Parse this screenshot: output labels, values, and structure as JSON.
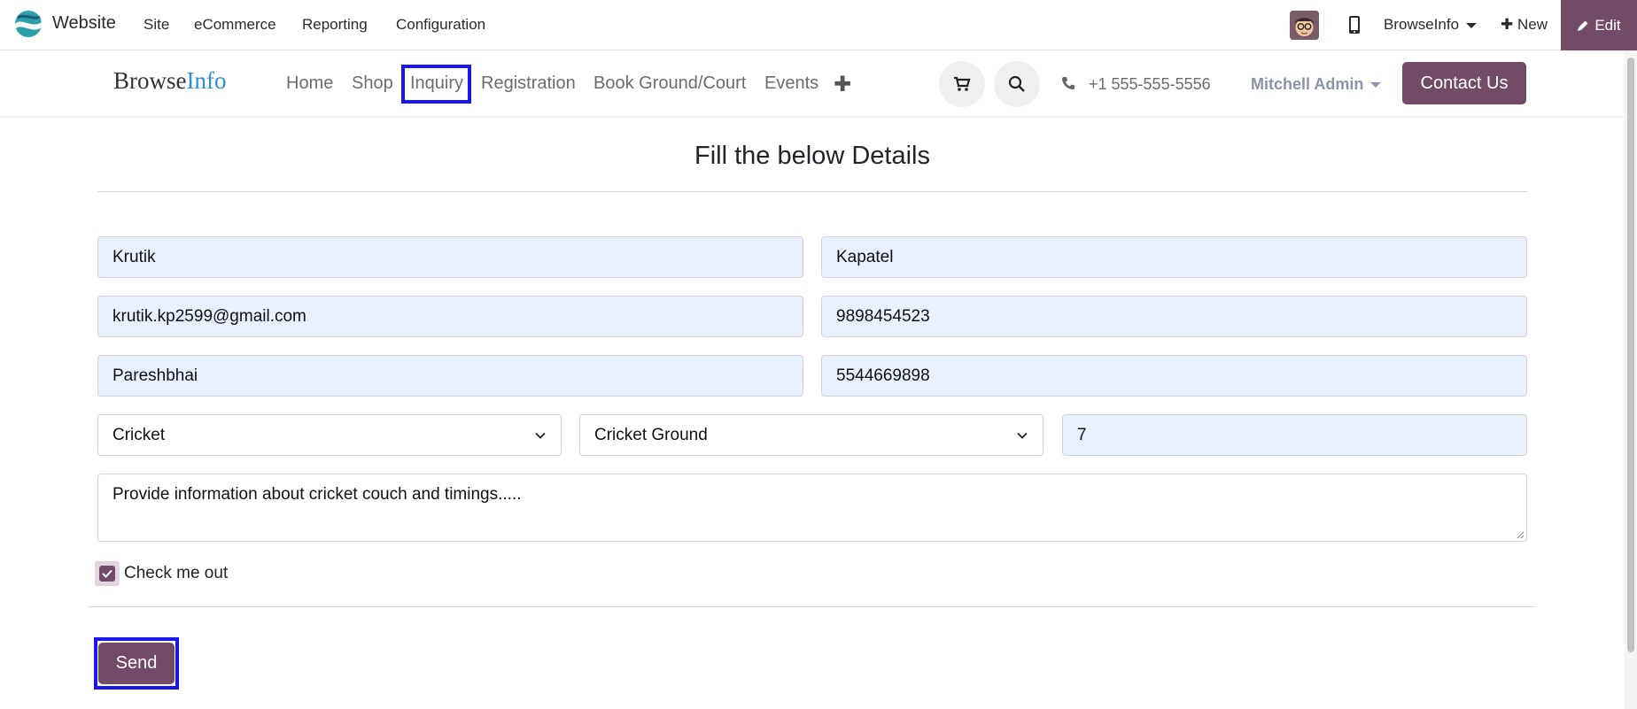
{
  "admin_bar": {
    "app_name": "Website",
    "menu": [
      "Site",
      "eCommerce",
      "Reporting",
      "Configuration"
    ],
    "website_switcher": "BrowseInfo",
    "new_label": "New",
    "edit_label": "Edit"
  },
  "site_header": {
    "brand_part1": "Browse",
    "brand_part2": "Info",
    "nav": [
      "Home",
      "Shop",
      "Inquiry",
      "Registration",
      "Book Ground/Court",
      "Events"
    ],
    "active_nav": "Inquiry",
    "phone": "+1 555-555-5556",
    "user": "Mitchell Admin",
    "contact_label": "Contact Us"
  },
  "form": {
    "title": "Fill the below Details",
    "first_name": "Krutik",
    "last_name": "Kapatel",
    "email": "krutik.kp2599@gmail.com",
    "phone": "9898454523",
    "father_name": "Pareshbhai",
    "alt_phone": "5544669898",
    "sport": "Cricket",
    "ground": "Cricket Ground",
    "quantity": "7",
    "message": "Provide information about cricket couch and timings.....",
    "checkbox_label": "Check me out",
    "checkbox_checked": true,
    "send_label": "Send"
  },
  "colors": {
    "brand": "#714b67",
    "highlight": "#1a16ee",
    "autofill": "#e8f0fe"
  }
}
